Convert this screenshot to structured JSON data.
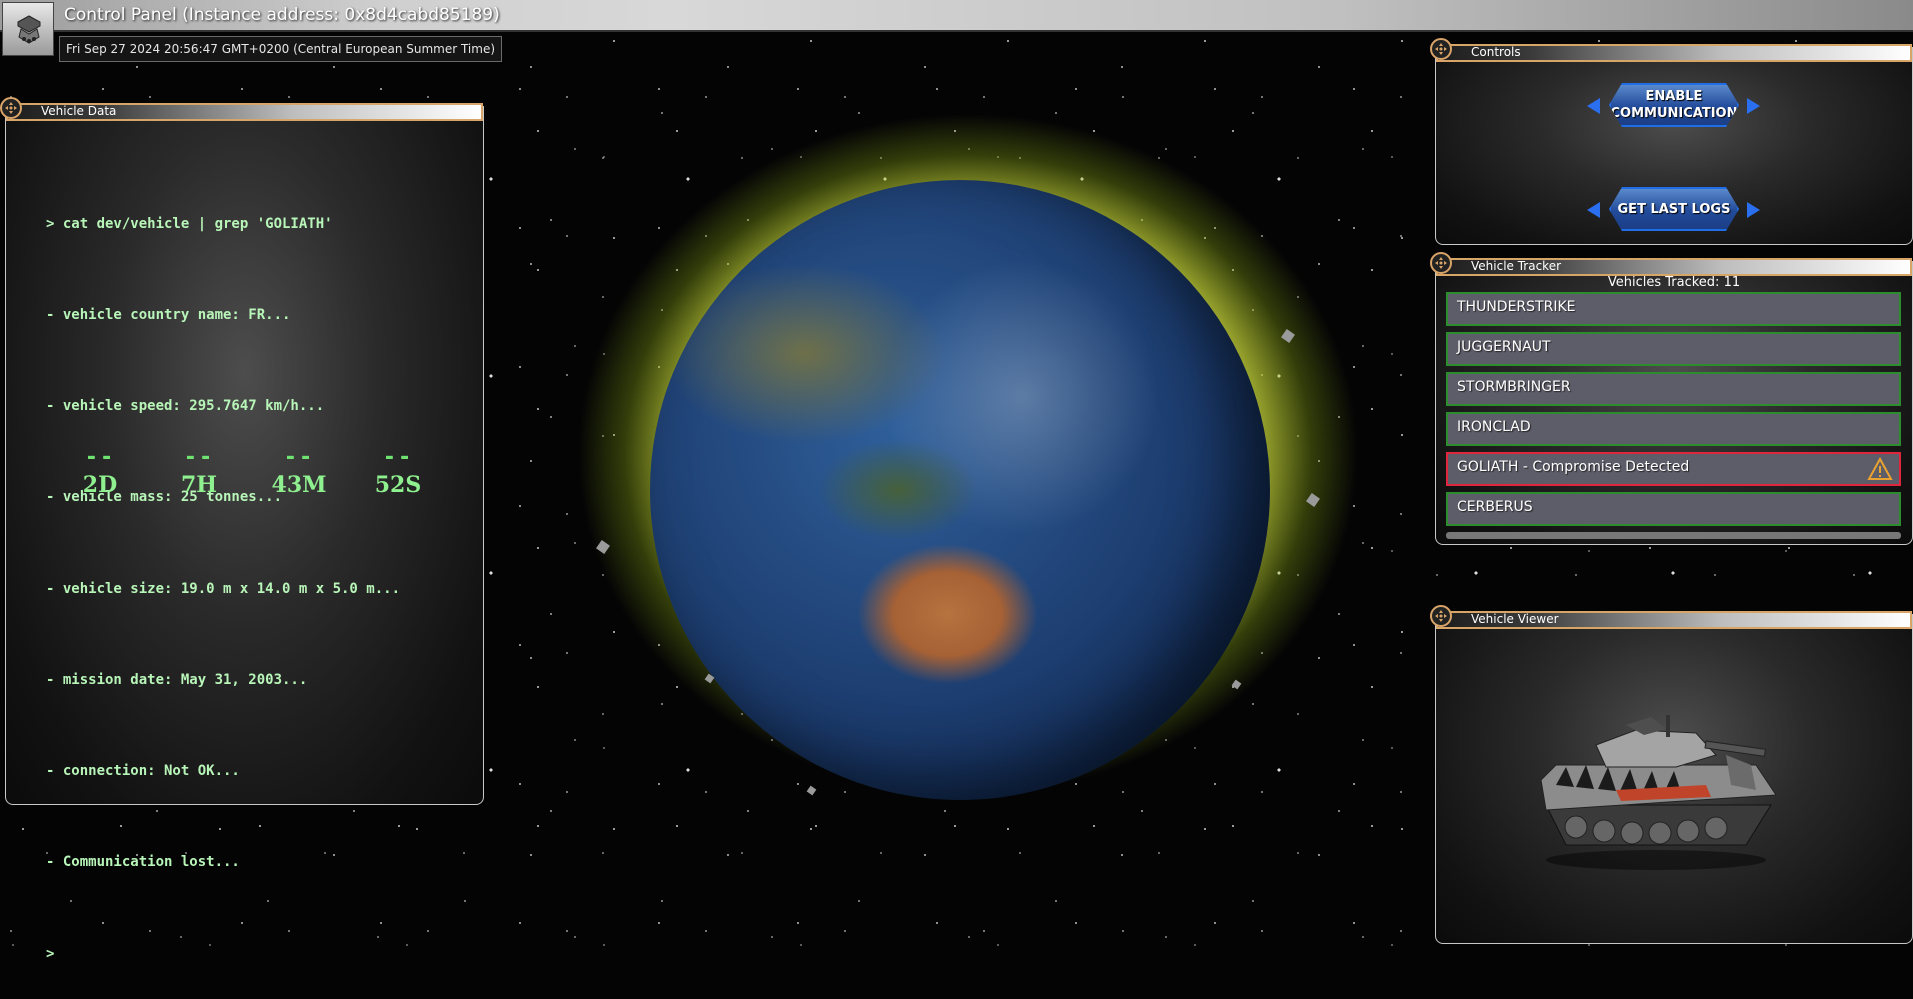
{
  "window": {
    "title": "Control Panel (Instance address: 0x8d4cabd85189)",
    "datetime": "Fri Sep 27 2024 20:56:47 GMT+0200 (Central European Summer Time)"
  },
  "vehicle_data": {
    "title": "Vehicle Data",
    "lines": [
      "> cat dev/vehicle | grep 'GOLIATH'",
      "- vehicle country name: FR...",
      "- vehicle speed: 295.7647 km/h...",
      "- vehicle mass: 25 tonnes...",
      "- vehicle size: 19.0 m x 14.0 m x 5.0 m...",
      "- mission date: May 31, 2003...",
      "- connection: Not OK...",
      "- Communication lost...",
      ">"
    ],
    "countdown": [
      {
        "dash": "--",
        "value": "2D"
      },
      {
        "dash": "--",
        "value": "7H"
      },
      {
        "dash": "--",
        "value": "43M"
      },
      {
        "dash": "--",
        "value": "52S"
      }
    ]
  },
  "controls": {
    "title": "Controls",
    "enable_label_line1": "ENABLE",
    "enable_label_line2": "COMMUNICATION",
    "logs_label": "GET LAST LOGS"
  },
  "tracker": {
    "title": "Vehicle Tracker",
    "count_text": "Vehicles Tracked: 11",
    "vehicles": [
      {
        "name": "THUNDERSTRIKE",
        "alert": false
      },
      {
        "name": "JUGGERNAUT",
        "alert": false
      },
      {
        "name": "STORMBRINGER",
        "alert": false
      },
      {
        "name": "IRONCLAD",
        "alert": false
      },
      {
        "name": "GOLIATH - Compromise Detected",
        "alert": true
      },
      {
        "name": "CERBERUS",
        "alert": false
      }
    ]
  },
  "viewer": {
    "title": "Vehicle Viewer"
  },
  "colors": {
    "accent_gold": "#d9a468",
    "terminal_green": "#b8f5b8",
    "button_blue": "#2a6ff0",
    "alert_red": "#e0263c",
    "ok_green": "#2d8c2d"
  },
  "icons": [
    "app-logo-icon",
    "move-handle-icon",
    "warning-icon",
    "arrow-left-icon",
    "arrow-right-icon"
  ]
}
